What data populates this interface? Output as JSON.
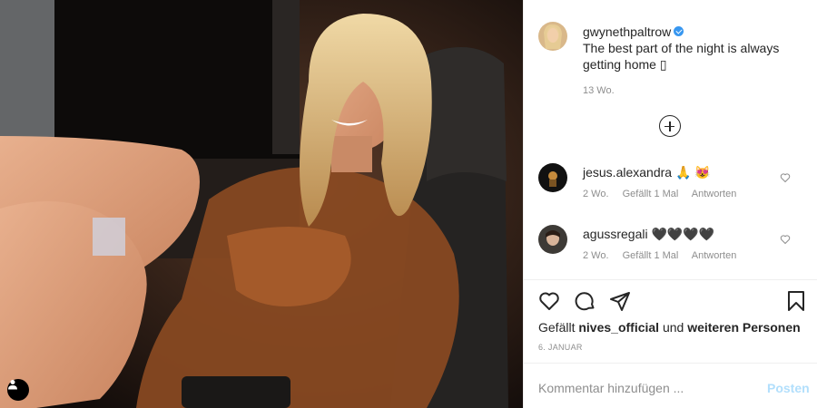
{
  "post": {
    "author": "gwynethpaltrow",
    "caption": "The best part of the night is always getting home ▯",
    "age": "13 Wo."
  },
  "comments": [
    {
      "user": "jesus.alexandra",
      "text": "🙏 😻",
      "age": "2 Wo.",
      "likes": "Gefällt 1 Mal",
      "reply": "Antworten"
    },
    {
      "user": "agussregali",
      "text": "🖤🖤🖤🖤",
      "age": "2 Wo.",
      "likes": "Gefällt 1 Mal",
      "reply": "Antworten"
    }
  ],
  "likes": {
    "prefix": "Gefällt",
    "user": "nives_official",
    "middle": "und",
    "suffix": "weiteren Personen"
  },
  "date": "6. JANUAR",
  "comment_box": {
    "placeholder": "Kommentar hinzufügen ...",
    "post_label": "Posten"
  },
  "colors": {
    "link_blue": "#3897f0",
    "post_disabled": "#b2dffc",
    "muted": "#8e8e8e"
  }
}
